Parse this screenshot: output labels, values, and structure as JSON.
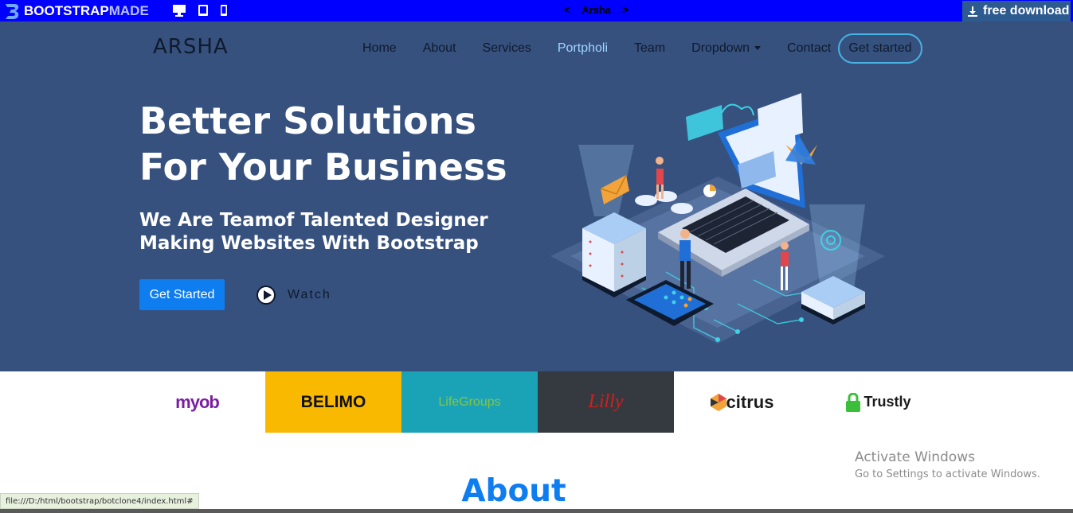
{
  "demo_bar": {
    "logo_text_a": "BOOTSTRAP",
    "logo_text_b": "MADE",
    "device_icons": [
      "desktop-icon",
      "tablet-icon",
      "phone-icon"
    ],
    "prev_arrow": "<",
    "theme_name": "Arsha",
    "next_arrow": ">",
    "download_label": "free download"
  },
  "header": {
    "brand": "ARSHA",
    "nav": [
      "Home",
      "About",
      "Services",
      "Portpholi",
      "Team",
      "Dropdown",
      "Contact"
    ],
    "cta": "Get started"
  },
  "hero": {
    "title": "Better Solutions For Your Business",
    "subtitle": "We Are Teamof Talented Designer Making Websites With Bootstrap",
    "primary_button": "Get Started",
    "watch_label": "Watch"
  },
  "clients": [
    "myob",
    "BELIMO",
    "LifeGroups",
    "Lilly",
    "citrus",
    "Trustly"
  ],
  "windows_notice": {
    "title": "Activate Windows",
    "message": "Go to Settings to activate Windows."
  },
  "about": {
    "title": "About"
  },
  "status_bar": {
    "url": "file:///D:/html/bootstrap/botclone4/index.html#"
  },
  "colors": {
    "demo_bar": "#0000ff",
    "hero_bg": "#37517e",
    "accent_blue": "#0d7df0",
    "active_nav": "#9fd6ff"
  }
}
